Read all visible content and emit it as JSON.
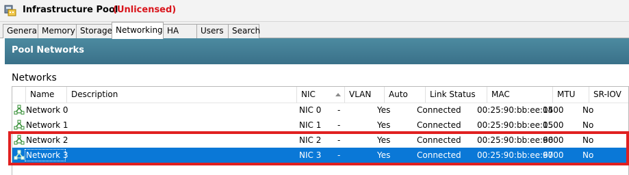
{
  "window": {
    "title": "Infrastructure Pool",
    "status": "(Unlicensed)",
    "icon": "pool-icon"
  },
  "tabs": [
    {
      "label": "General",
      "active": false
    },
    {
      "label": "Memory",
      "active": false
    },
    {
      "label": "Storage",
      "active": false
    },
    {
      "label": "Networking",
      "active": true
    },
    {
      "label": "HA",
      "active": false
    },
    {
      "label": "Users",
      "active": false
    },
    {
      "label": "Search",
      "active": false
    }
  ],
  "panel": {
    "title": "Pool Networks",
    "section": "Networks"
  },
  "table": {
    "columns": [
      "Name",
      "Description",
      "NIC",
      "VLAN",
      "Auto",
      "Link Status",
      "MAC",
      "MTU",
      "SR-IOV"
    ],
    "sorted_column": "NIC",
    "sort_direction": "ascending",
    "rows": [
      {
        "name": "Network 0",
        "description": "",
        "nic": "NIC 0",
        "vlan": "-",
        "auto": "Yes",
        "link_status": "Connected",
        "mac": "00:25:90:bb:ee:04",
        "mtu": "1500",
        "sriov": "No"
      },
      {
        "name": "Network 1",
        "description": "",
        "nic": "NIC 1",
        "vlan": "-",
        "auto": "Yes",
        "link_status": "Connected",
        "mac": "00:25:90:bb:ee:05",
        "mtu": "1500",
        "sriov": "No"
      },
      {
        "name": "Network 2",
        "description": "",
        "nic": "NIC 2",
        "vlan": "-",
        "auto": "Yes",
        "link_status": "Connected",
        "mac": "00:25:90:bb:ee:66",
        "mtu": "9000",
        "sriov": "No"
      },
      {
        "name": "Network 3",
        "description": "",
        "nic": "NIC 3",
        "vlan": "-",
        "auto": "Yes",
        "link_status": "Connected",
        "mac": "00:25:90:bb:ee:67",
        "mtu": "9000",
        "sriov": "No",
        "selected": true
      }
    ]
  },
  "colors": {
    "unlicensed_red": "#d9141b",
    "banner": "#3f7a92",
    "selection": "#0a78d7",
    "highlight_box": "#e02020"
  }
}
